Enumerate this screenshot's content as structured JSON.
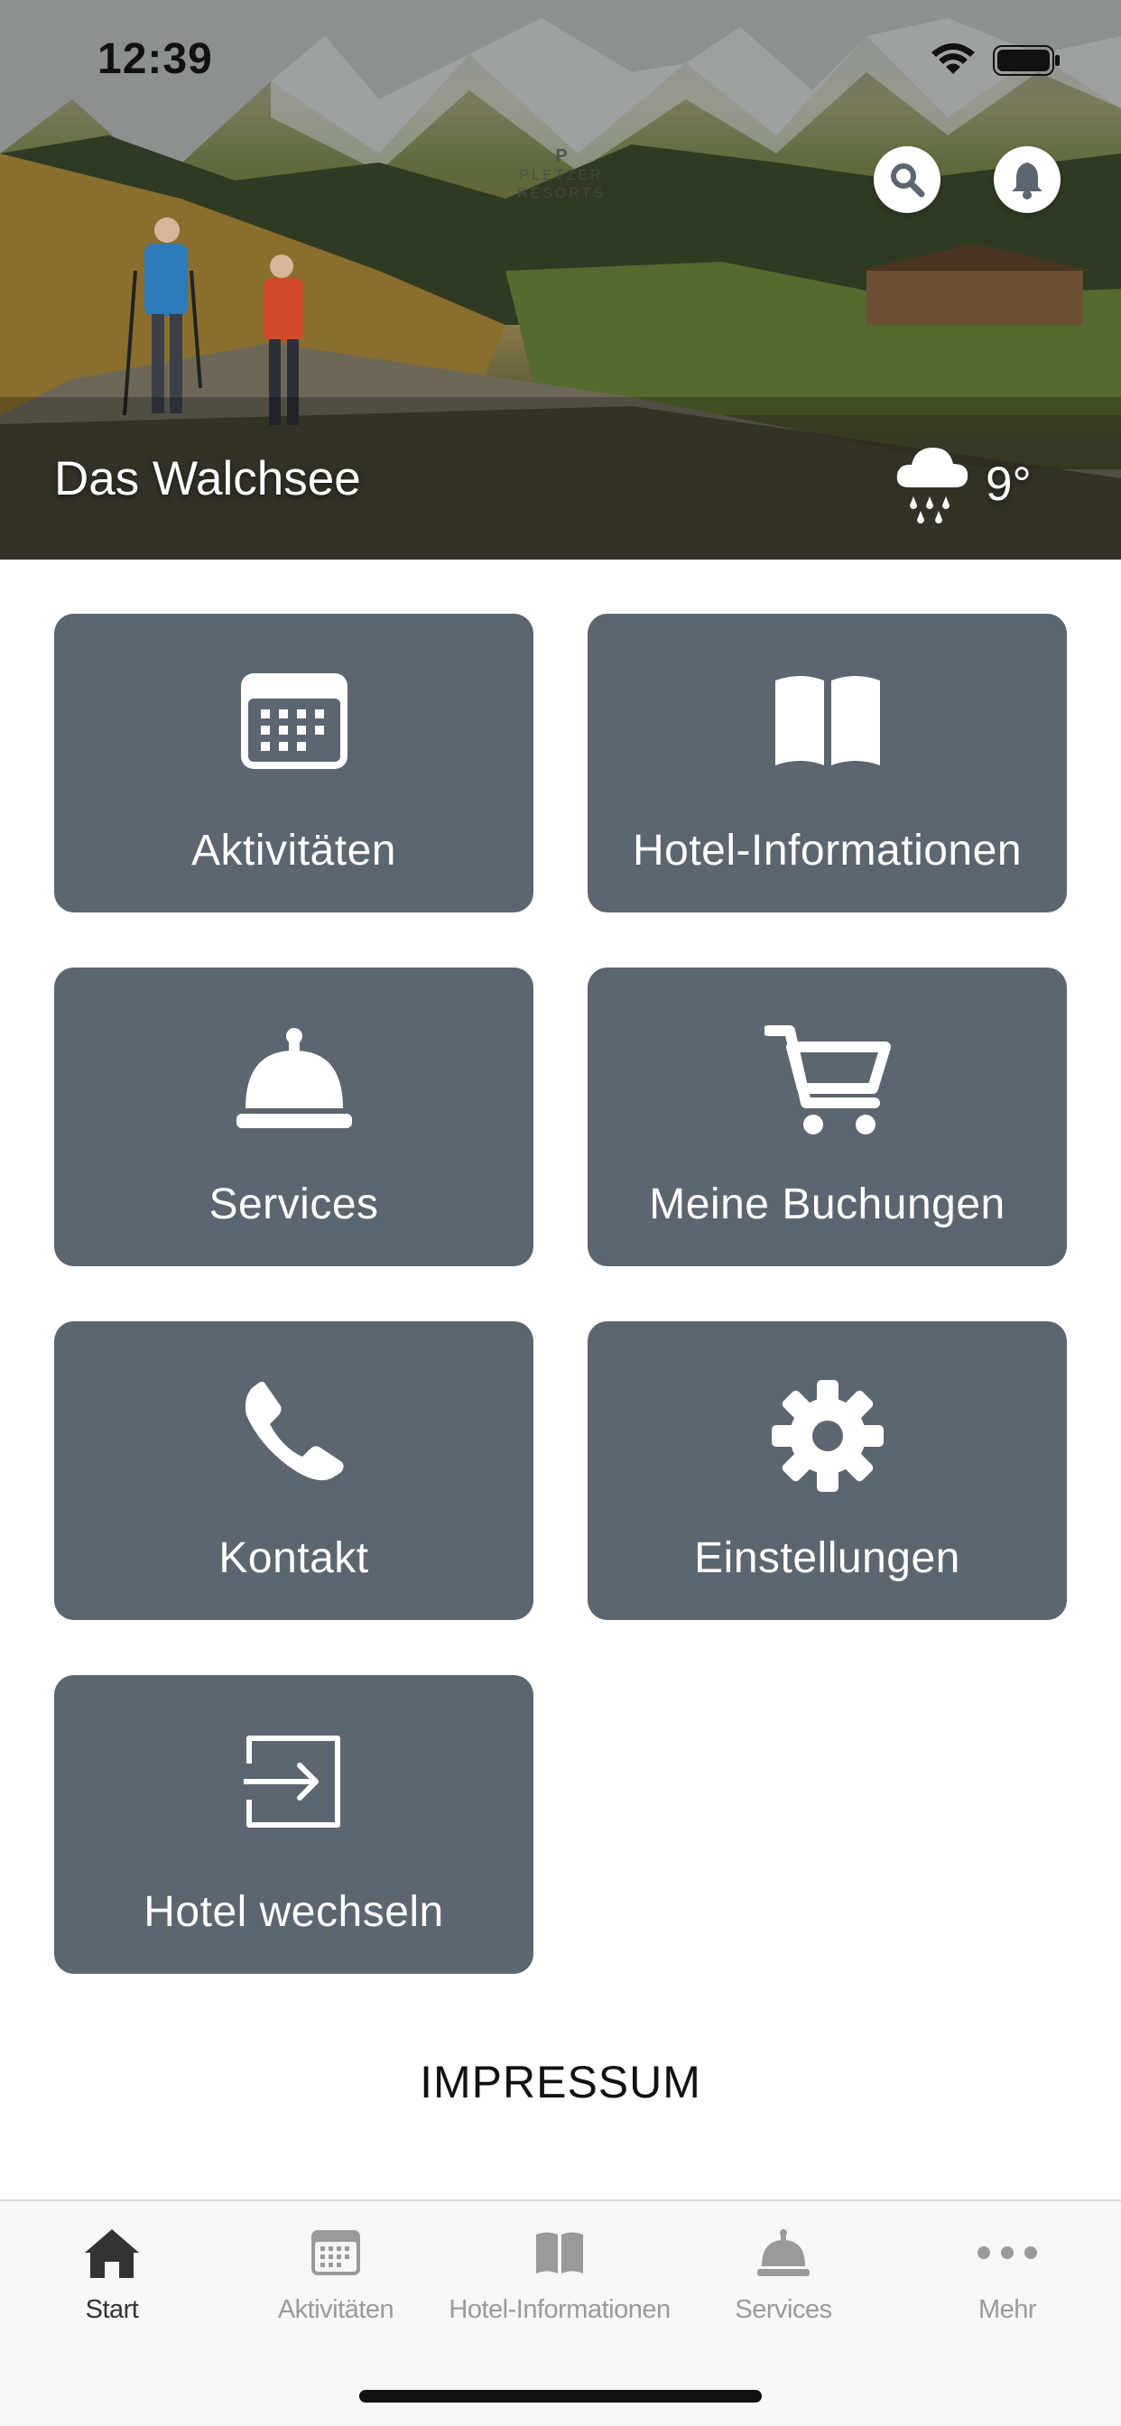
{
  "status_bar": {
    "time": "12:39"
  },
  "header": {
    "brand_mark": "P",
    "brand_name_line1": "PLETZER",
    "brand_name_line2": "RESORTS",
    "hotel_name": "Das Walchsee",
    "weather": {
      "icon": "rain-cloud-icon",
      "temperature": "9°"
    }
  },
  "tiles": [
    {
      "label": "Aktivitäten",
      "icon": "calendar-icon"
    },
    {
      "label": "Hotel-Informationen",
      "icon": "book-icon"
    },
    {
      "label": "Services",
      "icon": "service-bell-icon"
    },
    {
      "label": "Meine Buchungen",
      "icon": "cart-icon"
    },
    {
      "label": "Kontakt",
      "icon": "phone-icon"
    },
    {
      "label": "Einstellungen",
      "icon": "gear-icon"
    },
    {
      "label": "Hotel wechseln",
      "icon": "enter-icon"
    }
  ],
  "footer_link": "IMPRESSUM",
  "tabbar": {
    "items": [
      {
        "label": "Start",
        "icon": "home-icon",
        "active": true
      },
      {
        "label": "Aktivitäten",
        "icon": "calendar-icon",
        "active": false
      },
      {
        "label": "Hotel-Informationen",
        "icon": "book-icon",
        "active": false
      },
      {
        "label": "Services",
        "icon": "service-bell-icon",
        "active": false
      },
      {
        "label": "Mehr",
        "icon": "more-icon",
        "active": false
      }
    ]
  },
  "colors": {
    "tile_bg": "#5c6670",
    "tab_active": "#333333",
    "tab_inactive": "#9a9a9a"
  }
}
